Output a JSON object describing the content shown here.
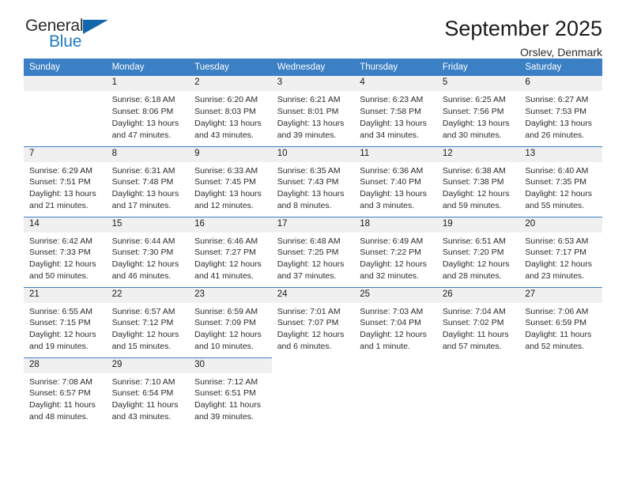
{
  "brand": {
    "name_part1": "General",
    "name_part2": "Blue",
    "triangle_color": "#1266ab",
    "blue_color": "#1b7ac4"
  },
  "header": {
    "title": "September 2025",
    "location": "Orslev, Denmark"
  },
  "colors": {
    "header_row": "#3b7fc4",
    "daynum_band": "#f0f0f0",
    "text": "#2b2b2b"
  },
  "weekdays": [
    "Sunday",
    "Monday",
    "Tuesday",
    "Wednesday",
    "Thursday",
    "Friday",
    "Saturday"
  ],
  "weeks": [
    [
      {
        "day": "",
        "blank": true,
        "sunrise": "",
        "sunset": "",
        "daylight1": "",
        "daylight2": ""
      },
      {
        "day": "1",
        "sunrise": "Sunrise: 6:18 AM",
        "sunset": "Sunset: 8:06 PM",
        "daylight1": "Daylight: 13 hours",
        "daylight2": "and 47 minutes."
      },
      {
        "day": "2",
        "sunrise": "Sunrise: 6:20 AM",
        "sunset": "Sunset: 8:03 PM",
        "daylight1": "Daylight: 13 hours",
        "daylight2": "and 43 minutes."
      },
      {
        "day": "3",
        "sunrise": "Sunrise: 6:21 AM",
        "sunset": "Sunset: 8:01 PM",
        "daylight1": "Daylight: 13 hours",
        "daylight2": "and 39 minutes."
      },
      {
        "day": "4",
        "sunrise": "Sunrise: 6:23 AM",
        "sunset": "Sunset: 7:58 PM",
        "daylight1": "Daylight: 13 hours",
        "daylight2": "and 34 minutes."
      },
      {
        "day": "5",
        "sunrise": "Sunrise: 6:25 AM",
        "sunset": "Sunset: 7:56 PM",
        "daylight1": "Daylight: 13 hours",
        "daylight2": "and 30 minutes."
      },
      {
        "day": "6",
        "sunrise": "Sunrise: 6:27 AM",
        "sunset": "Sunset: 7:53 PM",
        "daylight1": "Daylight: 13 hours",
        "daylight2": "and 26 minutes."
      }
    ],
    [
      {
        "day": "7",
        "sunrise": "Sunrise: 6:29 AM",
        "sunset": "Sunset: 7:51 PM",
        "daylight1": "Daylight: 13 hours",
        "daylight2": "and 21 minutes."
      },
      {
        "day": "8",
        "sunrise": "Sunrise: 6:31 AM",
        "sunset": "Sunset: 7:48 PM",
        "daylight1": "Daylight: 13 hours",
        "daylight2": "and 17 minutes."
      },
      {
        "day": "9",
        "sunrise": "Sunrise: 6:33 AM",
        "sunset": "Sunset: 7:45 PM",
        "daylight1": "Daylight: 13 hours",
        "daylight2": "and 12 minutes."
      },
      {
        "day": "10",
        "sunrise": "Sunrise: 6:35 AM",
        "sunset": "Sunset: 7:43 PM",
        "daylight1": "Daylight: 13 hours",
        "daylight2": "and 8 minutes."
      },
      {
        "day": "11",
        "sunrise": "Sunrise: 6:36 AM",
        "sunset": "Sunset: 7:40 PM",
        "daylight1": "Daylight: 13 hours",
        "daylight2": "and 3 minutes."
      },
      {
        "day": "12",
        "sunrise": "Sunrise: 6:38 AM",
        "sunset": "Sunset: 7:38 PM",
        "daylight1": "Daylight: 12 hours",
        "daylight2": "and 59 minutes."
      },
      {
        "day": "13",
        "sunrise": "Sunrise: 6:40 AM",
        "sunset": "Sunset: 7:35 PM",
        "daylight1": "Daylight: 12 hours",
        "daylight2": "and 55 minutes."
      }
    ],
    [
      {
        "day": "14",
        "sunrise": "Sunrise: 6:42 AM",
        "sunset": "Sunset: 7:33 PM",
        "daylight1": "Daylight: 12 hours",
        "daylight2": "and 50 minutes."
      },
      {
        "day": "15",
        "sunrise": "Sunrise: 6:44 AM",
        "sunset": "Sunset: 7:30 PM",
        "daylight1": "Daylight: 12 hours",
        "daylight2": "and 46 minutes."
      },
      {
        "day": "16",
        "sunrise": "Sunrise: 6:46 AM",
        "sunset": "Sunset: 7:27 PM",
        "daylight1": "Daylight: 12 hours",
        "daylight2": "and 41 minutes."
      },
      {
        "day": "17",
        "sunrise": "Sunrise: 6:48 AM",
        "sunset": "Sunset: 7:25 PM",
        "daylight1": "Daylight: 12 hours",
        "daylight2": "and 37 minutes."
      },
      {
        "day": "18",
        "sunrise": "Sunrise: 6:49 AM",
        "sunset": "Sunset: 7:22 PM",
        "daylight1": "Daylight: 12 hours",
        "daylight2": "and 32 minutes."
      },
      {
        "day": "19",
        "sunrise": "Sunrise: 6:51 AM",
        "sunset": "Sunset: 7:20 PM",
        "daylight1": "Daylight: 12 hours",
        "daylight2": "and 28 minutes."
      },
      {
        "day": "20",
        "sunrise": "Sunrise: 6:53 AM",
        "sunset": "Sunset: 7:17 PM",
        "daylight1": "Daylight: 12 hours",
        "daylight2": "and 23 minutes."
      }
    ],
    [
      {
        "day": "21",
        "sunrise": "Sunrise: 6:55 AM",
        "sunset": "Sunset: 7:15 PM",
        "daylight1": "Daylight: 12 hours",
        "daylight2": "and 19 minutes."
      },
      {
        "day": "22",
        "sunrise": "Sunrise: 6:57 AM",
        "sunset": "Sunset: 7:12 PM",
        "daylight1": "Daylight: 12 hours",
        "daylight2": "and 15 minutes."
      },
      {
        "day": "23",
        "sunrise": "Sunrise: 6:59 AM",
        "sunset": "Sunset: 7:09 PM",
        "daylight1": "Daylight: 12 hours",
        "daylight2": "and 10 minutes."
      },
      {
        "day": "24",
        "sunrise": "Sunrise: 7:01 AM",
        "sunset": "Sunset: 7:07 PM",
        "daylight1": "Daylight: 12 hours",
        "daylight2": "and 6 minutes."
      },
      {
        "day": "25",
        "sunrise": "Sunrise: 7:03 AM",
        "sunset": "Sunset: 7:04 PM",
        "daylight1": "Daylight: 12 hours",
        "daylight2": "and 1 minute."
      },
      {
        "day": "26",
        "sunrise": "Sunrise: 7:04 AM",
        "sunset": "Sunset: 7:02 PM",
        "daylight1": "Daylight: 11 hours",
        "daylight2": "and 57 minutes."
      },
      {
        "day": "27",
        "sunrise": "Sunrise: 7:06 AM",
        "sunset": "Sunset: 6:59 PM",
        "daylight1": "Daylight: 11 hours",
        "daylight2": "and 52 minutes."
      }
    ],
    [
      {
        "day": "28",
        "sunrise": "Sunrise: 7:08 AM",
        "sunset": "Sunset: 6:57 PM",
        "daylight1": "Daylight: 11 hours",
        "daylight2": "and 48 minutes."
      },
      {
        "day": "29",
        "sunrise": "Sunrise: 7:10 AM",
        "sunset": "Sunset: 6:54 PM",
        "daylight1": "Daylight: 11 hours",
        "daylight2": "and 43 minutes."
      },
      {
        "day": "30",
        "sunrise": "Sunrise: 7:12 AM",
        "sunset": "Sunset: 6:51 PM",
        "daylight1": "Daylight: 11 hours",
        "daylight2": "and 39 minutes."
      },
      {
        "day": "",
        "blank": true,
        "sunrise": "",
        "sunset": "",
        "daylight1": "",
        "daylight2": ""
      },
      {
        "day": "",
        "blank": true,
        "sunrise": "",
        "sunset": "",
        "daylight1": "",
        "daylight2": ""
      },
      {
        "day": "",
        "blank": true,
        "sunrise": "",
        "sunset": "",
        "daylight1": "",
        "daylight2": ""
      },
      {
        "day": "",
        "blank": true,
        "sunrise": "",
        "sunset": "",
        "daylight1": "",
        "daylight2": ""
      }
    ]
  ]
}
